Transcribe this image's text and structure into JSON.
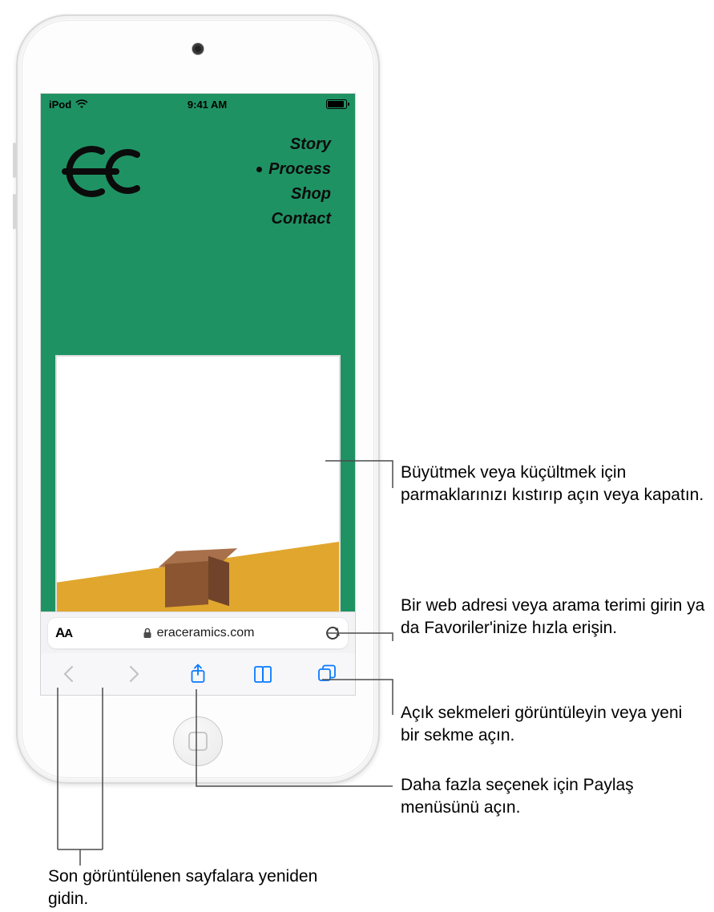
{
  "status": {
    "device_label": "iPod",
    "time": "9:41 AM"
  },
  "webpage": {
    "nav": {
      "items": [
        {
          "label": "Story",
          "active": false
        },
        {
          "label": "Process",
          "active": true
        },
        {
          "label": "Shop",
          "active": false
        },
        {
          "label": "Contact",
          "active": false
        }
      ]
    }
  },
  "url_bar": {
    "text_size_label": "AA",
    "domain": "eraceramics.com"
  },
  "callouts": {
    "zoom": "Büyütmek veya küçültmek için parmaklarınızı kıstırıp açın veya kapatın.",
    "address": "Bir web adresi veya arama terimi girin ya da Favoriler'inize hızla erişin.",
    "tabs": "Açık sekmeleri görüntüleyin veya yeni bir sekme açın.",
    "share": "Daha fazla seçenek için Paylaş menüsünü açın.",
    "navback": "Son görüntülenen sayfalara yeniden gidin."
  },
  "colors": {
    "page_green": "#1f9264",
    "accent_orange": "#e1a62d",
    "ios_blue": "#0a7aff"
  }
}
